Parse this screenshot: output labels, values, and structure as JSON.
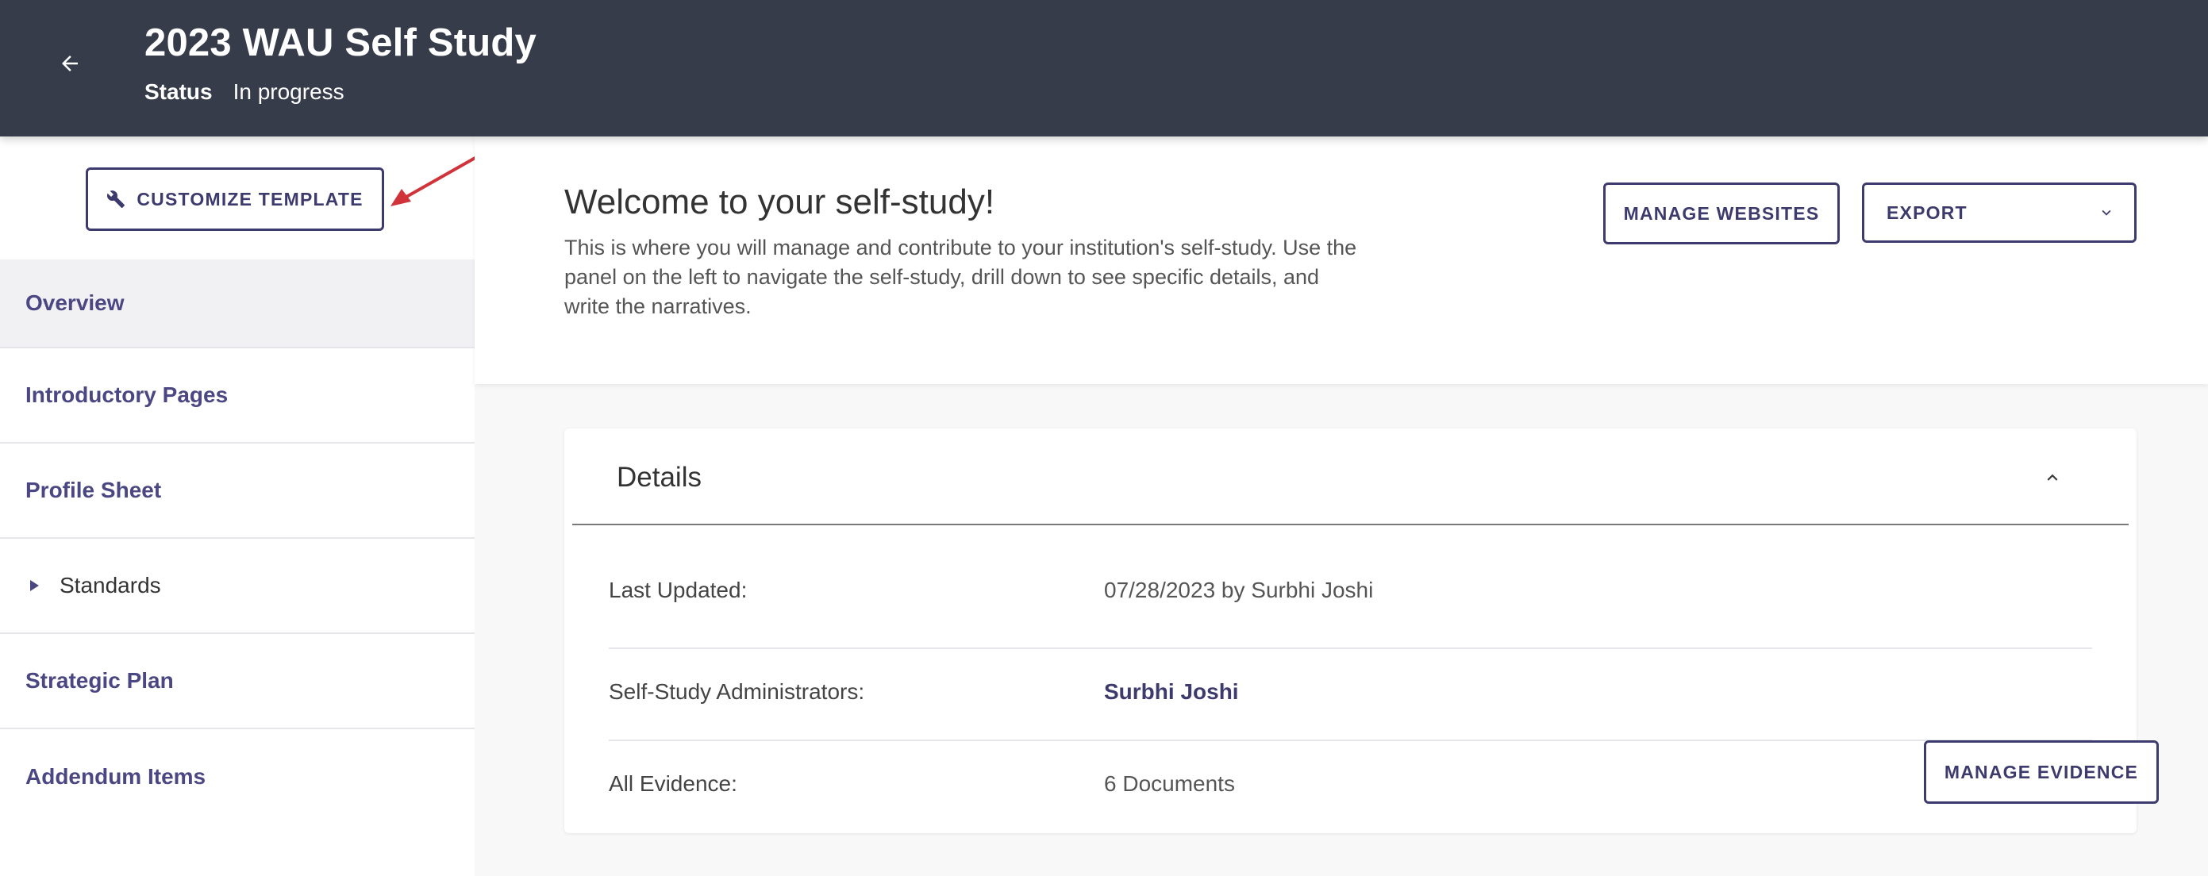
{
  "header": {
    "back_icon": "arrow-left-icon",
    "title": "2023 WAU Self Study",
    "status_label": "Status",
    "status_value": "In progress"
  },
  "sidebar": {
    "customize_button": {
      "icon": "wrench-icon",
      "label": "CUSTOMIZE TEMPLATE"
    },
    "items": [
      {
        "label": "Overview",
        "active": true
      },
      {
        "label": "Introductory Pages"
      },
      {
        "label": "Profile Sheet"
      },
      {
        "label": "Standards",
        "expandable": true
      },
      {
        "label": "Strategic Plan"
      },
      {
        "label": "Addendum Items"
      }
    ]
  },
  "welcome": {
    "title": "Welcome to your self-study!",
    "text": "This is where you will manage and contribute to your institution's self-study. Use the panel on the left to navigate the self-study, drill down to see specific details, and write the narratives.",
    "manage_websites_label": "MANAGE WEBSITES",
    "export_label": "EXPORT"
  },
  "details": {
    "title": "Details",
    "rows": [
      {
        "label": "Last Updated:",
        "value": "07/28/2023 by Surbhi Joshi"
      },
      {
        "label": "Self-Study Administrators:",
        "value": "Surbhi Joshi"
      },
      {
        "label": "All Evidence:",
        "value": "6 Documents"
      }
    ],
    "manage_evidence_label": "MANAGE EVIDENCE"
  },
  "colors": {
    "header_bg": "#363c4a",
    "accent": "#3d3b6e",
    "annotation_arrow": "#d0333a"
  }
}
